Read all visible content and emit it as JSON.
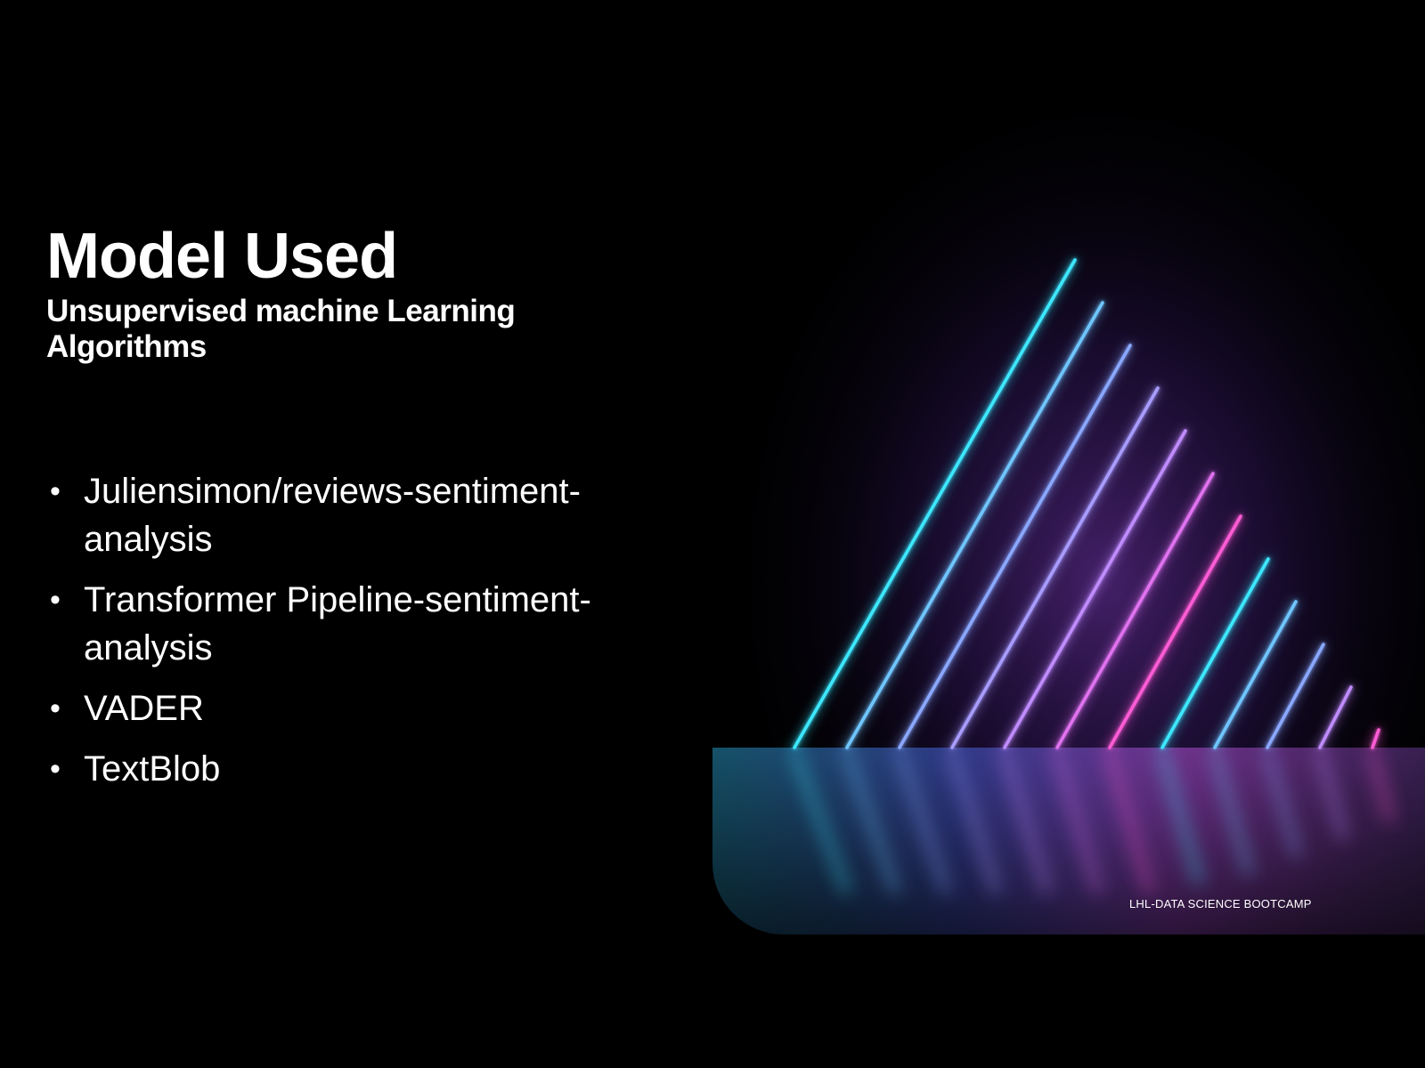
{
  "slide": {
    "title": "Model Used",
    "subtitle": "Unsupervised machine Learning Algorithms",
    "bullet_marker": "•",
    "bullets": [
      "Juliensimon/reviews-sentiment-analysis",
      "Transformer Pipeline-sentiment-analysis",
      "VADER",
      "TextBlob"
    ],
    "footer": "LHL-DATA SCIENCE BOOTCAMP"
  },
  "colors": {
    "background": "#000000",
    "text": "#ffffff",
    "neon_cyan": "#3ee8ff",
    "neon_blue": "#8aa8ff",
    "neon_violet": "#c08cff",
    "neon_pink": "#ff5cd6"
  }
}
